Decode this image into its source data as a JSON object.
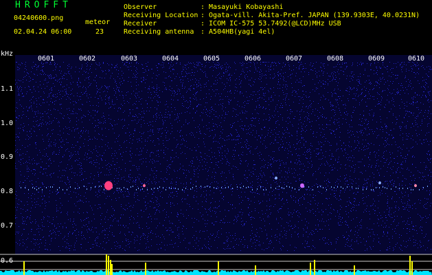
{
  "header": {
    "title": "HROFFT",
    "filename": "04240600.png",
    "meteor_label": "meteor",
    "datetime": "02.04.24 06:00",
    "meteor_count": "23",
    "info": [
      {
        "label": "Observer",
        "value": ": Masayuki Kobayashi"
      },
      {
        "label": "Receiving Location",
        "value": ": Ogata-vill. Akita-Pref. JAPAN (139.9303E, 40.0231N)"
      },
      {
        "label": "Receiver",
        "value": ": ICOM IC-575 53.7492(@LCD)MHz USB"
      },
      {
        "label": "Receiving antenna",
        "value": ": A504HB(yagi 4el)"
      }
    ]
  },
  "plot": {
    "y_unit": "kHz",
    "y_ticks": [
      "1.1",
      "1.0",
      "0.9",
      "0.8",
      "0.7",
      "0.6"
    ],
    "x_ticks": [
      "0601",
      "0602",
      "0603",
      "0604",
      "0605",
      "0606",
      "0607",
      "0608",
      "0609",
      "0610"
    ]
  },
  "colors": {
    "background": "#000000",
    "noise": "#2a2adf",
    "text_yellow": "#ffff00",
    "title_green": "#00ff33",
    "signal_pink": "#ff4080",
    "level_cyan": "#00e5ff"
  }
}
